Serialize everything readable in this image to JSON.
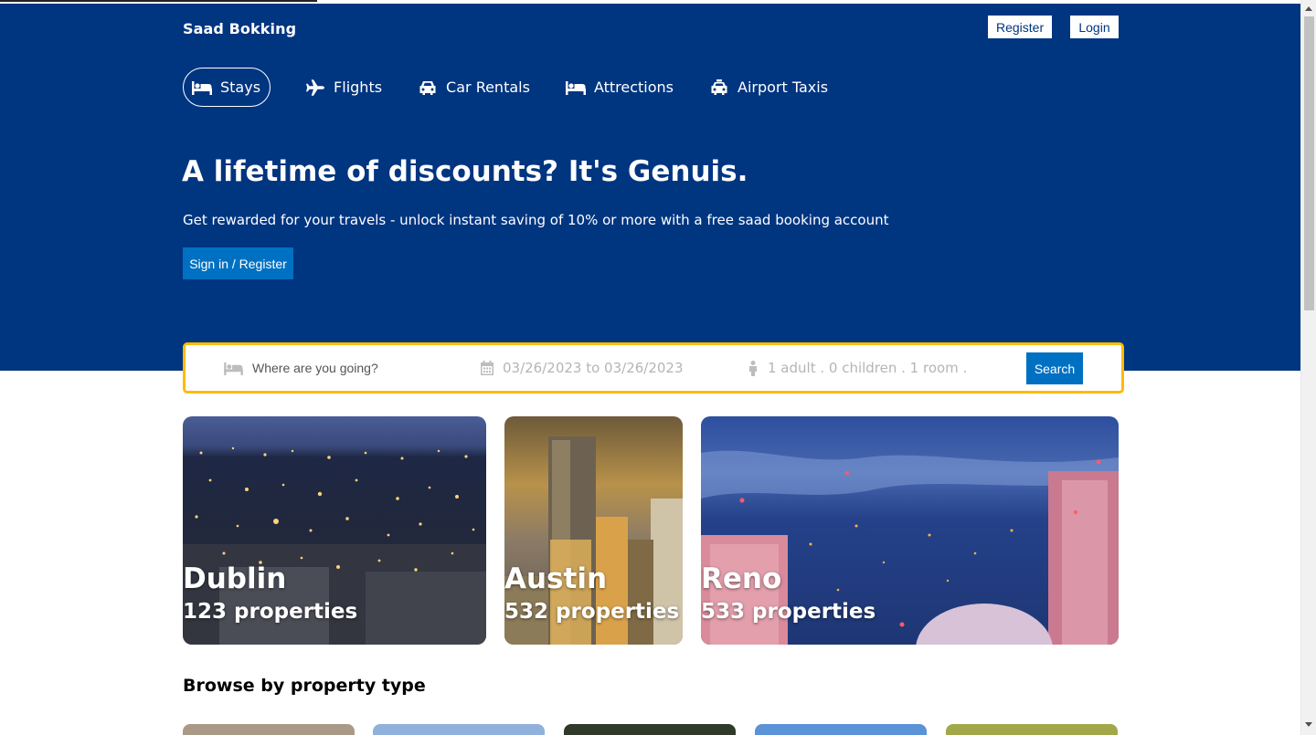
{
  "header": {
    "logo": "Saad Bokking",
    "register_label": "Register",
    "login_label": "Login"
  },
  "tabs": [
    {
      "label": "Stays",
      "icon": "bed-icon",
      "active": true
    },
    {
      "label": "Flights",
      "icon": "plane-icon"
    },
    {
      "label": "Car Rentals",
      "icon": "car-icon"
    },
    {
      "label": "Attrections",
      "icon": "bed-icon"
    },
    {
      "label": "Airport Taxis",
      "icon": "taxi-icon"
    }
  ],
  "hero": {
    "title": "A lifetime of discounts? It's Genuis.",
    "subtitle": "Get rewarded for your travels - unlock instant saving of 10% or more with a free saad booking account",
    "button_label": "Sign in / Register"
  },
  "search": {
    "destination_placeholder": "Where are you going?",
    "dates": "03/26/2023 to 03/26/2023",
    "options": "1 adult . 0 children . 1 room .",
    "button_label": "Search",
    "accent_color": "#febb02"
  },
  "featured": [
    {
      "city": "Dublin",
      "properties": "123 properties"
    },
    {
      "city": "Austin",
      "properties": "532 properties"
    },
    {
      "city": "Reno",
      "properties": "533 properties"
    }
  ],
  "section": {
    "browse_title": "Browse by property type"
  },
  "colors": {
    "brand": "#003580",
    "button": "#0071c2"
  }
}
